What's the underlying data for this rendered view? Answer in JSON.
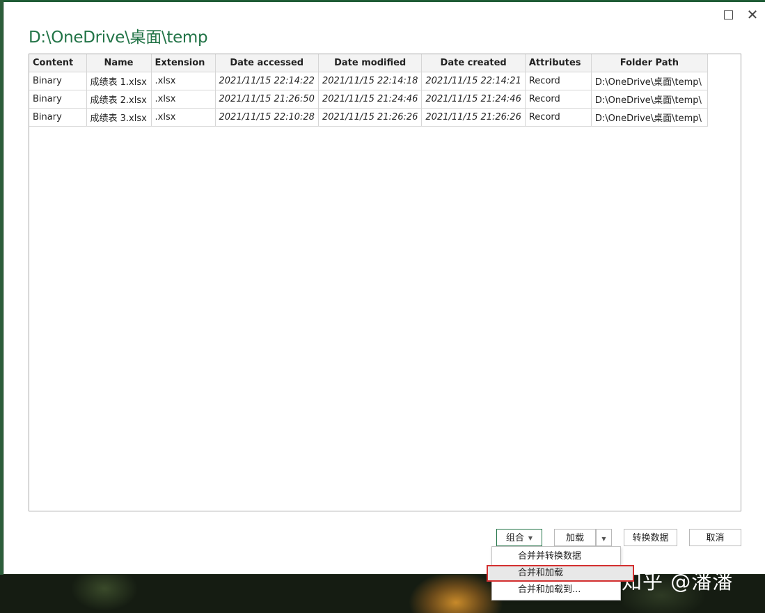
{
  "window": {
    "title": "D:\\OneDrive\\桌面\\temp",
    "maximize_icon": "maximize-icon",
    "close_label": "✕"
  },
  "table": {
    "columns": [
      "Content",
      "Name",
      "Extension",
      "Date accessed",
      "Date modified",
      "Date created",
      "Attributes",
      "Folder Path"
    ],
    "rows": [
      [
        "Binary",
        "成绩表 1.xlsx",
        ".xlsx",
        "2021/11/15 22:14:22",
        "2021/11/15 22:14:18",
        "2021/11/15 22:14:21",
        "Record",
        "D:\\OneDrive\\桌面\\temp\\"
      ],
      [
        "Binary",
        "成绩表 2.xlsx",
        ".xlsx",
        "2021/11/15 21:26:50",
        "2021/11/15 21:24:46",
        "2021/11/15 21:24:46",
        "Record",
        "D:\\OneDrive\\桌面\\temp\\"
      ],
      [
        "Binary",
        "成绩表 3.xlsx",
        ".xlsx",
        "2021/11/15 22:10:28",
        "2021/11/15 21:26:26",
        "2021/11/15 21:26:26",
        "Record",
        "D:\\OneDrive\\桌面\\temp\\"
      ]
    ]
  },
  "buttons": {
    "combine": "组合",
    "load": "加载",
    "transform": "转换数据",
    "cancel": "取消"
  },
  "combine_menu": {
    "items": [
      "合并并转换数据",
      "合并和加载",
      "合并和加载到..."
    ],
    "highlighted_index": 1
  },
  "watermark": "知乎 @潘潘",
  "colors": {
    "accent": "#217346",
    "highlight_border": "#d32f2f"
  }
}
